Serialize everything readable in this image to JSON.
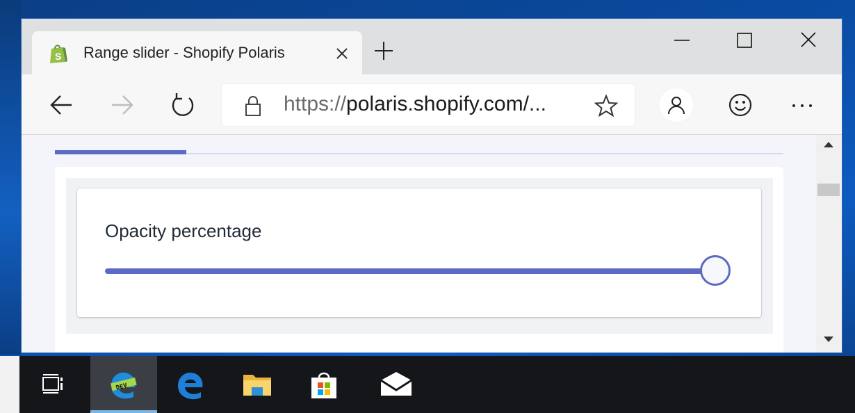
{
  "browser": {
    "tab": {
      "title": "Range slider - Shopify Polaris",
      "favicon": "shopify-bag-icon"
    },
    "address_bar": {
      "url_main": "https://",
      "url_host": "polaris.shopify.com/...",
      "lock_icon": "lock-icon"
    },
    "toolbar_icons": [
      "back-icon",
      "forward-icon",
      "refresh-icon",
      "favorite-star-icon",
      "profile-icon",
      "feedback-smiley-icon",
      "more-icon"
    ],
    "window_controls": [
      "minimize-icon",
      "maximize-icon",
      "close-icon"
    ]
  },
  "page": {
    "progress": 0.18,
    "card": {
      "label": "Opacity percentage",
      "slider_value_fraction": 1.0
    }
  },
  "colors": {
    "accent": "#5c6ac4",
    "titlebar": "#dfe0e1",
    "toolbar": "#f7f7f7",
    "taskbar": "#14161a"
  },
  "taskbar": {
    "apps": [
      "task-view-icon",
      "edge-dev-icon",
      "edge-icon",
      "file-explorer-icon",
      "store-icon",
      "mail-icon"
    ]
  }
}
